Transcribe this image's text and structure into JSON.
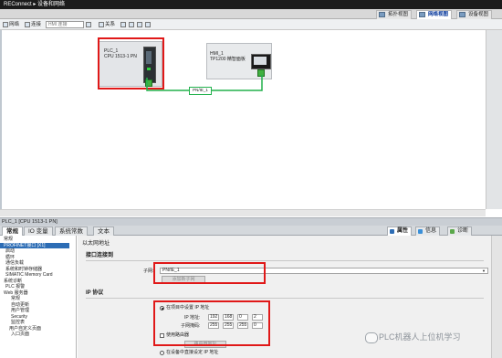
{
  "titlebar": {
    "project": "REConnect",
    "separator": "▸",
    "page": "设备和网络"
  },
  "views": {
    "topology": "拓扑视图",
    "network": "网络视图",
    "device": "设备视图"
  },
  "toolbar": {
    "network": "网络",
    "connection": "连接",
    "connection_type": "HMI 连接",
    "relation": "关系"
  },
  "devices": {
    "plc": {
      "name": "PLC_1",
      "model": "CPU 1513-1 PN"
    },
    "hmi": {
      "name": "HMI_1",
      "model": "TP1200 精智面板"
    }
  },
  "network_label": "PN/IE_1",
  "properties_title": "PLC_1 [CPU 1513-1 PN]",
  "tabs": [
    "常规",
    "IO 变量",
    "系统常数",
    "文本"
  ],
  "right_tabs": {
    "properties": "属性",
    "info": "信息",
    "diagnostics": "诊断"
  },
  "nav_items": [
    "常规",
    "PROFINET接口 [X1]",
    "启动",
    "循环",
    "通信负载",
    "系统和时钟存储器",
    "SIMATIC Memory Card",
    "系统诊断",
    "PLC 报警",
    "Web 服务器",
    "常规",
    "自动更新",
    "用户管理",
    "Security",
    "监控表",
    "用户自定义页面",
    "入口页面"
  ],
  "section_ethernet": "以太网地址",
  "section_interface": "接口连接到",
  "subnet_label": "子网:",
  "subnet_value": "PN/IE_1",
  "add_subnet": "添加新子网",
  "section_ip": "IP 协议",
  "ip_in_project": "在项目中设置 IP 地址",
  "ip_label": "IP 地址:",
  "ip_value": [
    "192",
    "168",
    "0",
    "2"
  ],
  "mask_label": "子网掩码:",
  "mask_value": [
    "255",
    "255",
    "255",
    "0"
  ],
  "use_router": "使用路由器",
  "router_label": "路由器地址",
  "ip_on_device": "在设备中直接设定 IP 地址",
  "watermark": "PLC机器人上位机学习"
}
